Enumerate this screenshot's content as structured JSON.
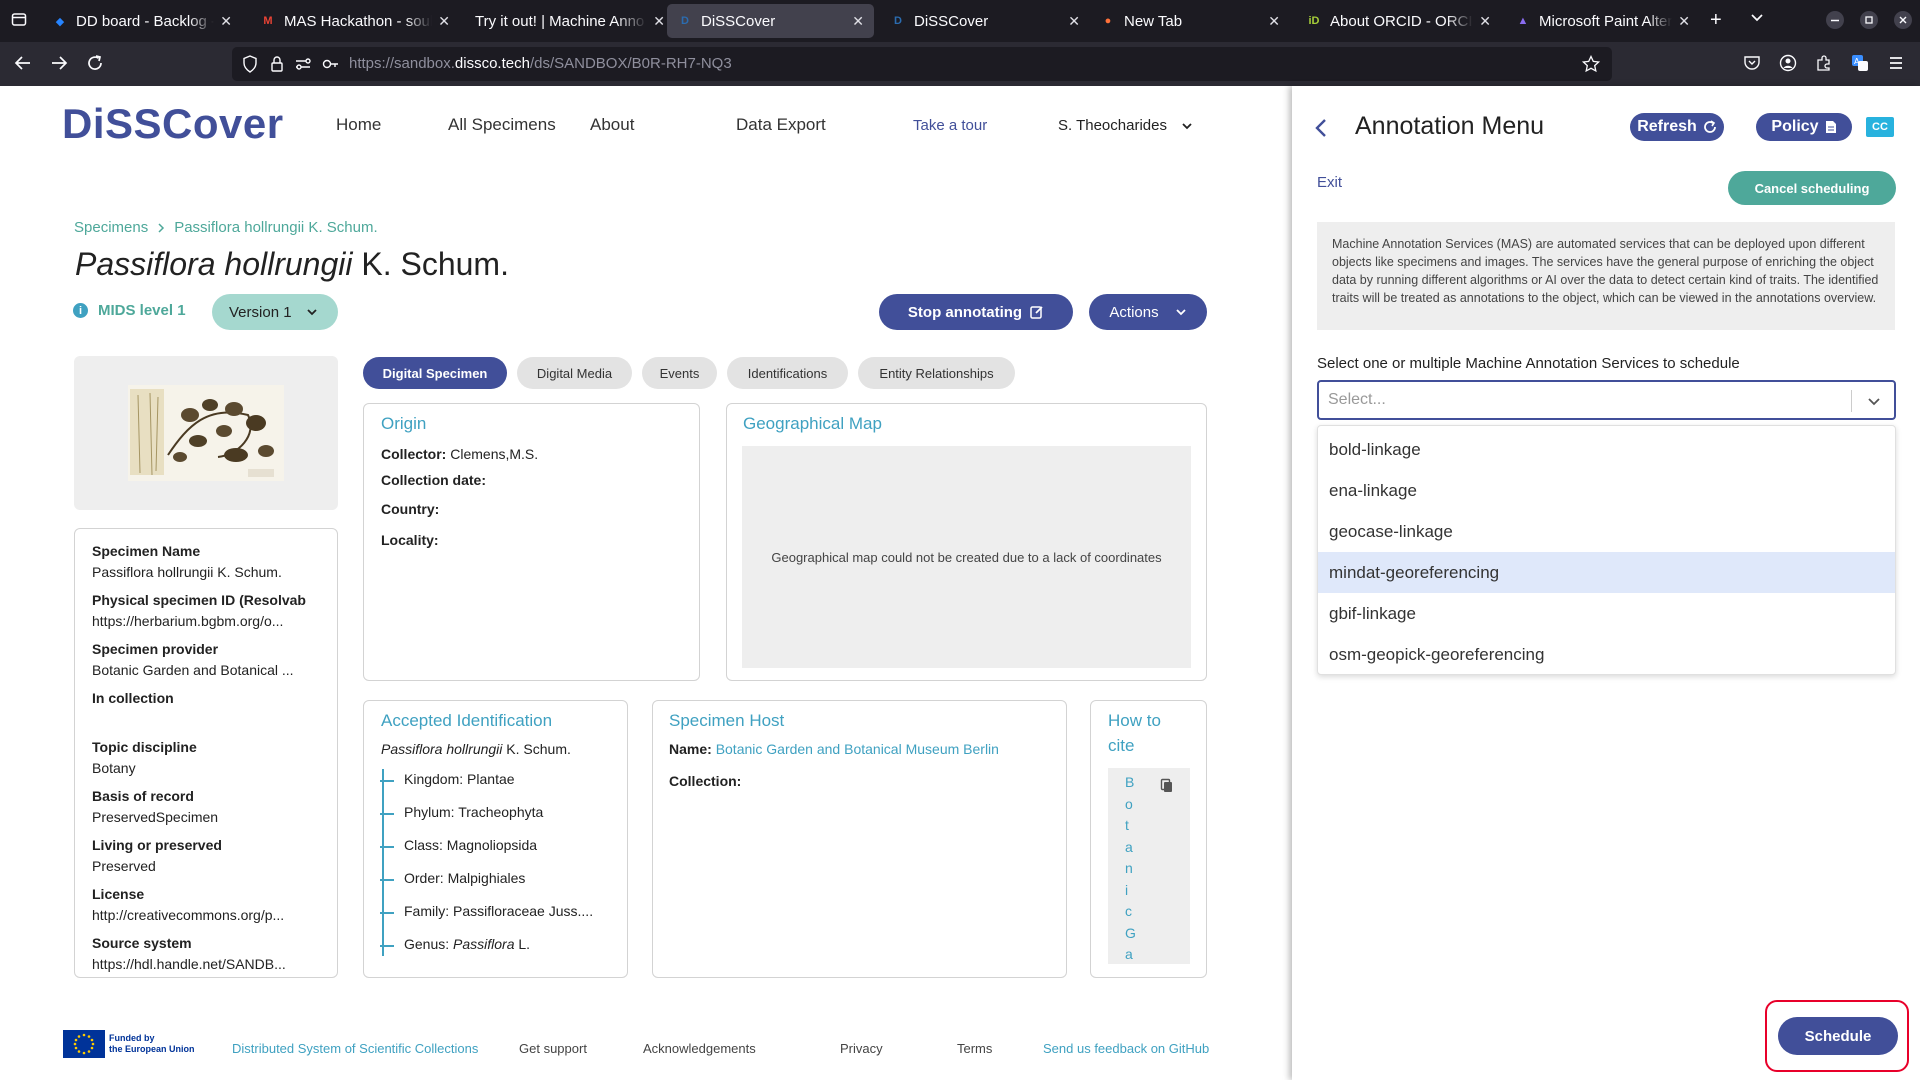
{
  "browser": {
    "tabs": [
      {
        "label": "DD board - Backlog - N",
        "favicon": "jira-icon",
        "active": false
      },
      {
        "label": "MAS Hackathon - soula",
        "favicon": "gmail-icon",
        "active": false
      },
      {
        "label": "Try it out! | Machine Anno",
        "favicon": "none",
        "active": false
      },
      {
        "label": "DiSSCover",
        "favicon": "dissco-icon",
        "active": true
      },
      {
        "label": "DiSSCover",
        "favicon": "dissco-icon",
        "active": false
      },
      {
        "label": "New Tab",
        "favicon": "firefox-icon",
        "active": false
      },
      {
        "label": "About ORCID - ORCID",
        "favicon": "orcid-icon",
        "active": false
      },
      {
        "label": "Microsoft Paint Altern",
        "favicon": "paint-icon",
        "active": false
      }
    ],
    "url_prefix": "https://sandbox.",
    "url_domain": "dissco.tech",
    "url_path": "/ds/SANDBOX/B0R-RH7-NQ3"
  },
  "header": {
    "logo": "DiSSCover",
    "nav": [
      "Home",
      "All Specimens",
      "About",
      "Data Export"
    ],
    "tour": "Take a tour",
    "user": "S. Theocharides"
  },
  "breadcrumb": {
    "root": "Specimens",
    "current": "Passiflora hollrungii K. Schum."
  },
  "specimen": {
    "title_genus_species": "Passiflora hollrungii",
    "title_author": "K. Schum.",
    "mids": "MIDS level 1",
    "version": "Version 1",
    "stop_annotating": "Stop annotating",
    "actions": "Actions"
  },
  "sidebar": [
    {
      "key": "Specimen Name",
      "value": "Passiflora hollrungii K. Schum."
    },
    {
      "key": "Physical specimen ID (Resolvab",
      "value": "https://herbarium.bgbm.org/o..."
    },
    {
      "key": "Specimen provider",
      "value": "Botanic Garden and Botanical ..."
    },
    {
      "key": "In collection",
      "value": ""
    },
    {
      "key": "Topic discipline",
      "value": "Botany"
    },
    {
      "key": "Basis of record",
      "value": "PreservedSpecimen"
    },
    {
      "key": "Living or preserved",
      "value": "Preserved"
    },
    {
      "key": "License",
      "value": "http://creativecommons.org/p..."
    },
    {
      "key": "Source system",
      "value": "https://hdl.handle.net/SANDB..."
    }
  ],
  "subtabs": [
    "Digital Specimen",
    "Digital Media",
    "Events",
    "Identifications",
    "Entity Relationships"
  ],
  "origin": {
    "title": "Origin",
    "collector_label": "Collector:",
    "collector_value": "Clemens,M.S.",
    "collection_date_label": "Collection date:",
    "country_label": "Country:",
    "locality_label": "Locality:"
  },
  "map": {
    "title": "Geographical Map",
    "message": "Geographical map could not be created due to a lack of coordinates"
  },
  "identification": {
    "title": "Accepted Identification",
    "name_italic": "Passiflora hollrungii",
    "name_author": "K. Schum.",
    "taxonomy": [
      {
        "rank": "Kingdom:",
        "value": "Plantae",
        "italic": false
      },
      {
        "rank": "Phylum:",
        "value": "Tracheophyta",
        "italic": false
      },
      {
        "rank": "Class:",
        "value": "Magnoliopsida",
        "italic": false
      },
      {
        "rank": "Order:",
        "value": "Malpighiales",
        "italic": false
      },
      {
        "rank": "Family:",
        "value": "Passifloraceae Juss....",
        "italic": false
      },
      {
        "rank": "Genus:",
        "value": "Passiflora",
        "author": "L.",
        "italic": true
      }
    ]
  },
  "host": {
    "title": "Specimen Host",
    "name_label": "Name:",
    "name_value": "Botanic Garden and Botanical Museum Berlin",
    "collection_label": "Collection:"
  },
  "cite": {
    "title_1": "How to",
    "title_2": "cite",
    "letters": [
      "B",
      "o",
      "t",
      "a",
      "n",
      "i",
      "c",
      "G",
      "a"
    ]
  },
  "footer": {
    "eu_funded_1": "Funded by",
    "eu_funded_2": "the European Union",
    "links": [
      "Distributed System of Scientific Collections",
      "Get support",
      "Acknowledgements",
      "Privacy",
      "Terms",
      "Send us feedback on GitHub"
    ]
  },
  "panel": {
    "title": "Annotation Menu",
    "refresh": "Refresh",
    "policy": "Policy",
    "cc": "CC",
    "exit": "Exit",
    "cancel_scheduling": "Cancel scheduling",
    "description": "Machine Annotation Services (MAS) are automated services that can be deployed upon different objects like specimens and images. The services have the general purpose of enriching the object data by running different algorithms or AI over the data to detect certain kind of traits. The identified traits will be treated as annotations to the object, which can be viewed in the annotations overview.",
    "select_label": "Select one or multiple Machine Annotation Services to schedule",
    "select_placeholder": "Select...",
    "options": [
      "bold-linkage",
      "ena-linkage",
      "geocase-linkage",
      "mindat-georeferencing",
      "gbif-linkage",
      "osm-geopick-georeferencing"
    ],
    "highlighted_option": "mindat-georeferencing",
    "schedule": "Schedule"
  },
  "colors": {
    "primary": "#414f99",
    "teal": "#4ea89a",
    "accent_blue": "#3fa1c1",
    "highlight_border": "#e8002a"
  }
}
